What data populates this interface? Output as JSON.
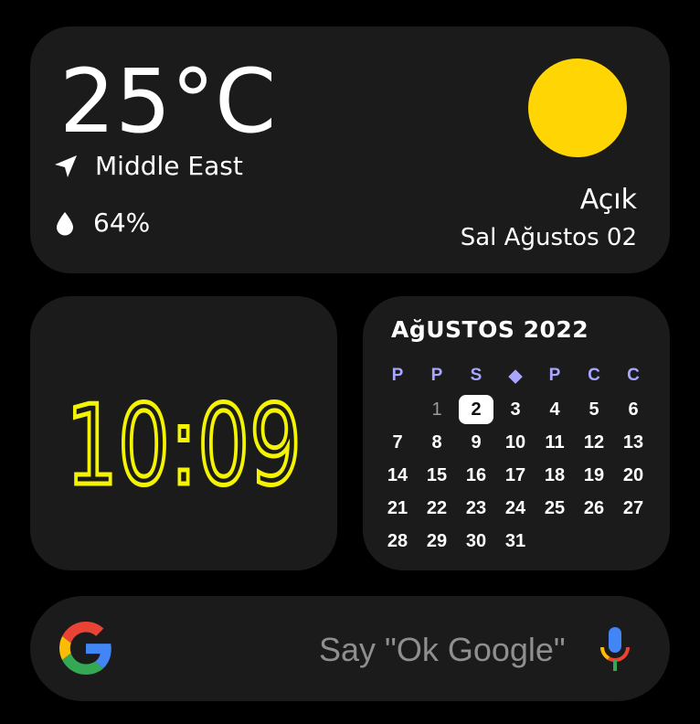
{
  "weather": {
    "temperature": "25°C",
    "location": "Middle East",
    "humidity": "64%",
    "condition": "Açık",
    "date": "Sal Ağustos 02",
    "sun_color": "#ffd603"
  },
  "clock": {
    "time": "10:09",
    "color": "#f5f400"
  },
  "calendar": {
    "title": "AğUSTOS 2022",
    "weekdays": [
      "P",
      "P",
      "S",
      "◆",
      "P",
      "C",
      "C"
    ],
    "today": "2",
    "weeks": [
      [
        "",
        "1",
        "2",
        "3",
        "4",
        "5",
        "6"
      ],
      [
        "7",
        "8",
        "9",
        "10",
        "11",
        "12",
        "13"
      ],
      [
        "14",
        "15",
        "16",
        "17",
        "18",
        "19",
        "20"
      ],
      [
        "21",
        "22",
        "23",
        "24",
        "25",
        "26",
        "27"
      ],
      [
        "28",
        "29",
        "30",
        "31",
        "",
        "",
        ""
      ]
    ],
    "weekday_color": "#a9a6ff"
  },
  "search": {
    "placeholder": "Say \"Ok Google\"",
    "logo_icon": "google-g-icon",
    "mic_icon": "mic-icon"
  }
}
